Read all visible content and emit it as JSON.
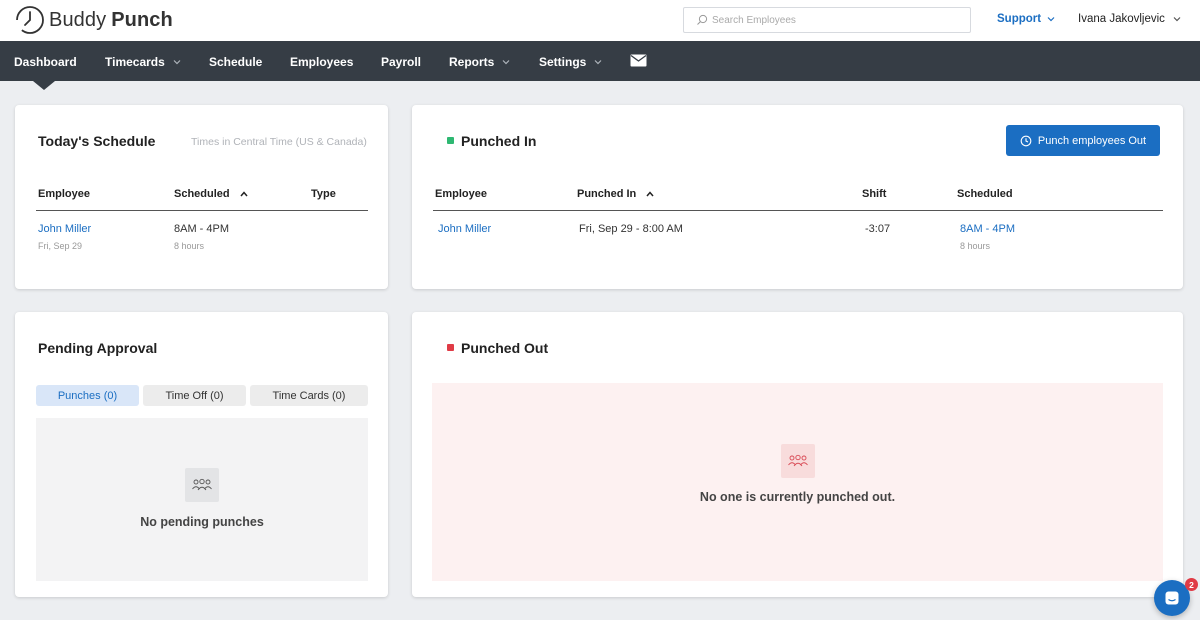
{
  "brand": {
    "name_part1": "Buddy",
    "name_part2": "Punch"
  },
  "header": {
    "search_placeholder": "Search Employees",
    "support_label": "Support",
    "user_name": "Ivana Jakovljevic"
  },
  "nav": {
    "items": [
      {
        "label": "Dashboard"
      },
      {
        "label": "Timecards"
      },
      {
        "label": "Schedule"
      },
      {
        "label": "Employees"
      },
      {
        "label": "Payroll"
      },
      {
        "label": "Reports"
      },
      {
        "label": "Settings"
      }
    ]
  },
  "schedule": {
    "title": "Today's Schedule",
    "timezone_note": "Times in Central Time (US & Canada)",
    "columns": [
      "Employee",
      "Scheduled",
      "Type"
    ],
    "rows": [
      {
        "employee": "John Miller",
        "date": "Fri, Sep 29",
        "scheduled": "8AM - 4PM",
        "duration": "8 hours",
        "type": ""
      }
    ]
  },
  "punched_in": {
    "title": "Punched In",
    "button_label": "Punch employees Out",
    "columns": [
      "Employee",
      "Punched In",
      "Shift",
      "Scheduled"
    ],
    "rows": [
      {
        "employee": "John Miller",
        "punched_in": "Fri, Sep 29 - 8:00 AM",
        "shift": "-3:07",
        "scheduled": "8AM - 4PM",
        "duration": "8 hours"
      }
    ]
  },
  "pending": {
    "title": "Pending Approval",
    "tabs": [
      {
        "label": "Punches (0)"
      },
      {
        "label": "Time Off (0)"
      },
      {
        "label": "Time Cards (0)"
      }
    ],
    "empty_text": "No pending punches"
  },
  "punched_out": {
    "title": "Punched Out",
    "empty_text": "No one is currently punched out."
  },
  "chat": {
    "badge_count": "2"
  },
  "colors": {
    "accent": "#1b6ec2",
    "nav_bg": "#363d45",
    "punched_in_dot": "#2eb872",
    "punched_out_dot": "#e03b46",
    "punched_out_bg": "#fdf1f1"
  }
}
